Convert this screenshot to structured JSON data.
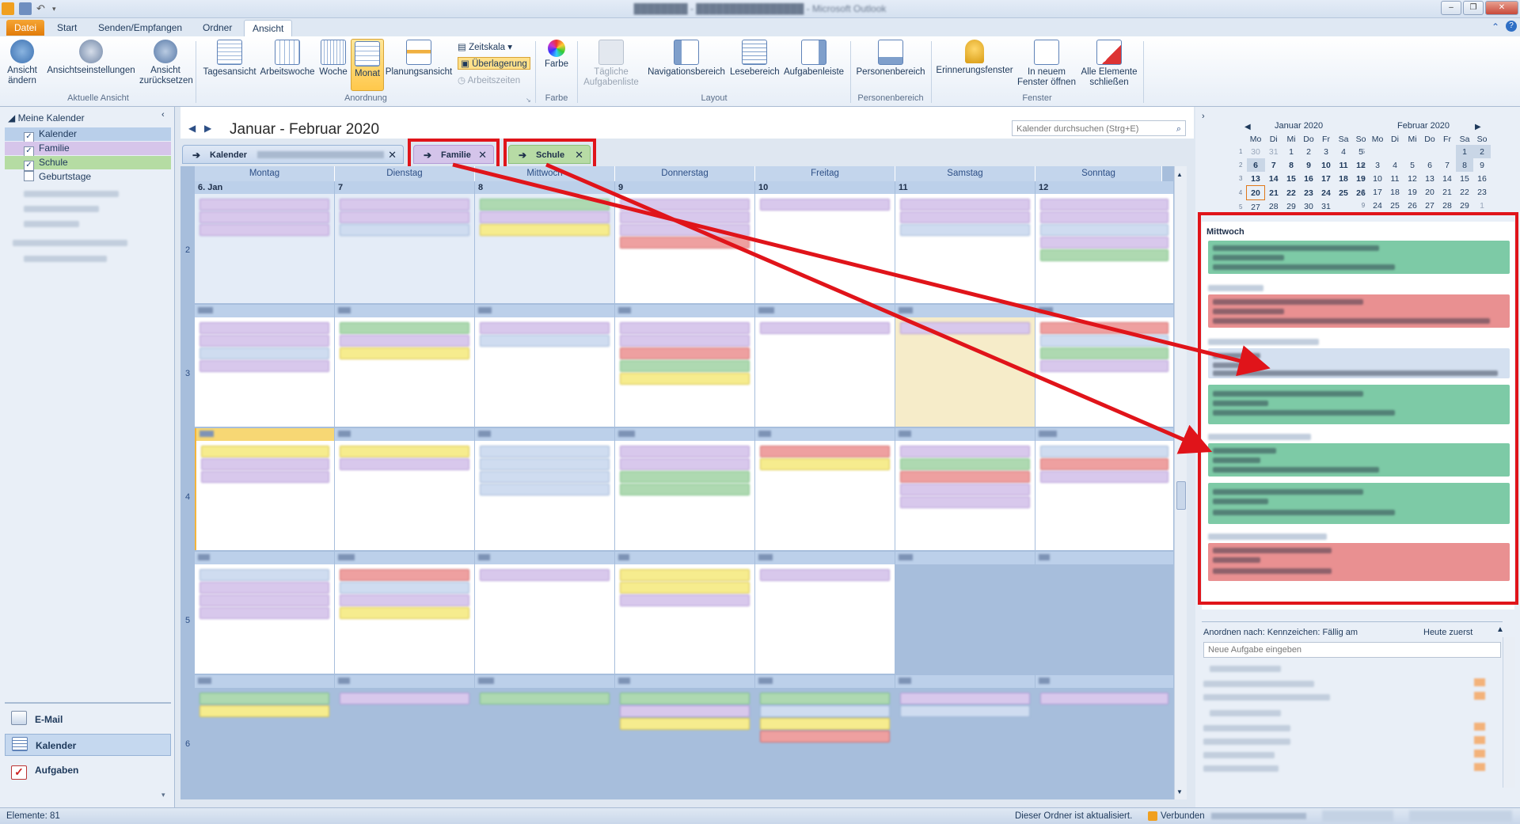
{
  "ribbon_tabs": [
    "Datei",
    "Start",
    "Senden/Empfangen",
    "Ordner",
    "Ansicht"
  ],
  "ribbon": {
    "ansicht_aendern": "Ansicht ändern",
    "ansichtseinstellungen": "Ansichtseinstellungen",
    "ansicht_zuruecksetzen": "Ansicht zurücksetzen",
    "group_aktuelle_ansicht": "Aktuelle Ansicht",
    "tagesansicht": "Tagesansicht",
    "arbeitswoche": "Arbeitswoche",
    "woche": "Woche",
    "monat": "Monat",
    "planungsansicht": "Planungsansicht",
    "zeitskala": "Zeitskala",
    "ueberlagerung": "Überlagerung",
    "arbeitszeiten": "Arbeitszeiten",
    "group_anordnung": "Anordnung",
    "farbe": "Farbe",
    "group_farbe": "Farbe",
    "taegliche_aufgabenliste": "Tägliche Aufgabenliste",
    "navigationsbereich": "Navigationsbereich",
    "lesebereich": "Lesebereich",
    "aufgabenleiste": "Aufgabenleiste",
    "group_layout": "Layout",
    "personenbereich": "Personenbereich",
    "group_personenbereich": "Personenbereich",
    "erinnerungsfenster": "Erinnerungsfenster",
    "in_neuem_fenster": "In neuem Fenster öffnen",
    "alle_schliessen": "Alle Elemente schließen",
    "group_fenster": "Fenster"
  },
  "nav": {
    "meine_kalender": "Meine Kalender",
    "calendars": [
      "Kalender",
      "Familie",
      "Schule",
      "Geburtstage"
    ],
    "bottom": [
      "E-Mail",
      "Kalender",
      "Aufgaben"
    ]
  },
  "calendar": {
    "title": "Januar - Februar 2020",
    "search_placeholder": "Kalender durchsuchen (Strg+E)",
    "tabs": [
      "Kalender",
      "Familie",
      "Schule"
    ],
    "days": [
      "Montag",
      "Dienstag",
      "Mittwoch",
      "Donnerstag",
      "Freitag",
      "Samstag",
      "Sonntag"
    ],
    "week_numbers": [
      "2",
      "3",
      "4",
      "5",
      "6"
    ],
    "first_row_dates": [
      "6. Jan",
      "7",
      "8",
      "9",
      "10",
      "11",
      "12"
    ]
  },
  "minical": {
    "jan_title": "Januar 2020",
    "feb_title": "Februar 2020",
    "weekdays": [
      "Mo",
      "Di",
      "Mi",
      "Do",
      "Fr",
      "Sa",
      "So"
    ],
    "jan_rows": [
      [
        "1",
        "30",
        "31",
        "1",
        "2",
        "3",
        "4",
        "5"
      ],
      [
        "2",
        "6",
        "7",
        "8",
        "9",
        "10",
        "11",
        "12"
      ],
      [
        "3",
        "13",
        "14",
        "15",
        "16",
        "17",
        "18",
        "19"
      ],
      [
        "4",
        "20",
        "21",
        "22",
        "23",
        "24",
        "25",
        "26"
      ],
      [
        "5",
        "27",
        "28",
        "29",
        "30",
        "31",
        "",
        ""
      ]
    ],
    "feb_rows": [
      [
        "5",
        "",
        "",
        "",
        "",
        "",
        "1",
        "2"
      ],
      [
        "6",
        "3",
        "4",
        "5",
        "6",
        "7",
        "8",
        "9"
      ],
      [
        "7",
        "10",
        "11",
        "12",
        "13",
        "14",
        "15",
        "16"
      ],
      [
        "8",
        "17",
        "18",
        "19",
        "20",
        "21",
        "22",
        "23"
      ],
      [
        "9",
        "24",
        "25",
        "26",
        "27",
        "28",
        "29",
        "1"
      ]
    ]
  },
  "agenda": {
    "day_label": "Mittwoch"
  },
  "tasks": {
    "arrange": "Anordnen nach: Kennzeichen: Fällig am",
    "order": "Heute zuerst",
    "new_task_placeholder": "Neue Aufgabe eingeben"
  },
  "status": {
    "elements": "Elemente: 81",
    "updated": "Dieser Ordner ist aktualisiert.",
    "connected": "Verbunden"
  }
}
